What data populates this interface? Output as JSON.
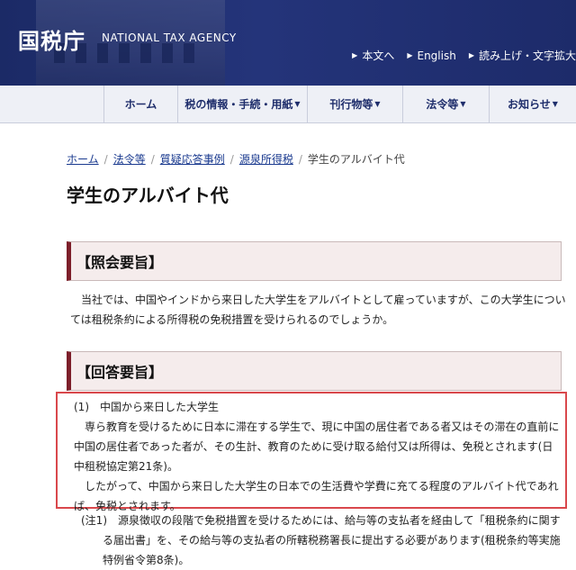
{
  "header": {
    "logo": "国税庁",
    "logo_en": "NATIONAL TAX AGENCY",
    "util_links": [
      {
        "label": "本文へ"
      },
      {
        "label": "English"
      },
      {
        "label": "読み上げ・文字拡大"
      }
    ]
  },
  "gnav": {
    "items": [
      {
        "label": "ホーム"
      },
      {
        "label": "税の情報・手続・用紙"
      },
      {
        "label": "刊行物等"
      },
      {
        "label": "法令等"
      },
      {
        "label": "お知らせ"
      }
    ]
  },
  "breadcrumb": {
    "items": [
      "ホーム",
      "法令等",
      "質疑応答事例",
      "源泉所得税"
    ],
    "current": "学生のアルバイト代"
  },
  "page": {
    "title": "学生のアルバイト代",
    "inquiry_heading": "【照会要旨】",
    "inquiry_text": "当社では、中国やインドから来日した大学生をアルバイトとして雇っていますが、この大学生については租税条約による所得税の免税措置を受けられるのでしょうか。",
    "answer_heading": "【回答要旨】",
    "answer_item_title": "(1)　中国から来日した大学生",
    "answer_para1": "専ら教育を受けるために日本に滞在する学生で、現に中国の居住者である者又はその滞在の直前に中国の居住者であった者が、その生計、教育のために受け取る給付又は所得は、免税とされます(日中租税協定第21条)。",
    "answer_para2": "したがって、中国から来日した大学生の日本での生活費や学費に充てる程度のアルバイト代であれば、免税とされます。",
    "note_text": "(注1)　源泉徴収の段階で免税措置を受けるためには、給与等の支払者を経由して「租税条約に関する届出書」を、その給与等の支払者の所轄税務署長に提出する必要があります(租税条約等実施特例省令第8条)。"
  },
  "colors": {
    "header_bg": "#1d2b6a",
    "accent": "#7d1f2a",
    "highlight": "#d9484c",
    "link": "#1a3a8f"
  }
}
